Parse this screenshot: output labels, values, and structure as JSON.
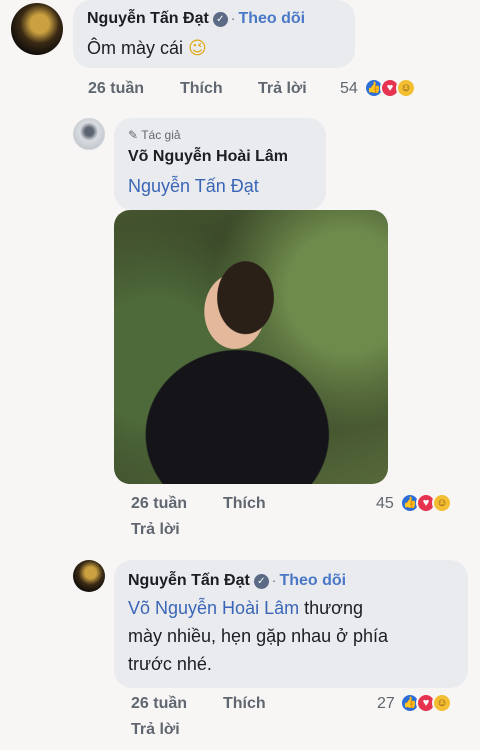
{
  "comments": [
    {
      "author": "Nguyễn Tấn Đạt",
      "follow": "Theo dõi",
      "text": "Ôm mày cái",
      "text_emoji": "😉",
      "time": "26 tuần",
      "like": "Thích",
      "reply": "Trả lời",
      "reaction_count": "54"
    },
    {
      "author_badge": "Tác giả",
      "author": "Võ Nguyễn Hoài Lâm",
      "mention": "Nguyễn Tấn Đạt",
      "time": "26 tuần",
      "like": "Thích",
      "reply": "Trả lời",
      "reaction_count": "45"
    },
    {
      "author": "Nguyễn Tấn Đạt",
      "follow": "Theo dõi",
      "mention": "Võ Nguyễn Hoài Lâm",
      "text_line1": "thương",
      "text_line2": "mày nhiều, hẹn gặp nhau ở phía",
      "text_line3": "trước nhé.",
      "time": "26 tuần",
      "like": "Thích",
      "reply": "Trả lời",
      "reaction_count": "27"
    }
  ],
  "icons": {
    "verified": "verified-check-icon",
    "author_badge": "pencil-icon",
    "reactions": [
      "like-icon",
      "love-icon",
      "care-icon"
    ]
  },
  "colors": {
    "bubble": "#e9ebee",
    "link": "#4a78c7",
    "like": "#2d6fd9",
    "love": "#e6334f",
    "care": "#f3be31"
  }
}
